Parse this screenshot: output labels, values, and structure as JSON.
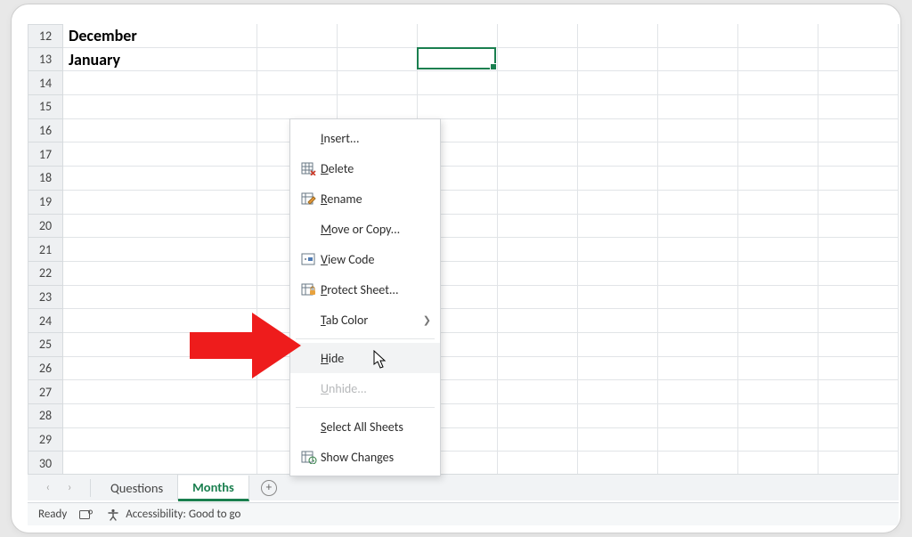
{
  "rows": {
    "start": 12,
    "end": 30,
    "data": {
      "12": {
        "A": "December"
      },
      "13": {
        "A": "January"
      }
    }
  },
  "selection": {
    "cell": "D13"
  },
  "tabs": {
    "items": [
      {
        "name": "Questions",
        "active": false
      },
      {
        "name": "Months",
        "active": true
      }
    ]
  },
  "context_menu": {
    "items": [
      {
        "label_pre": "",
        "mnemonic": "I",
        "label_post": "nsert...",
        "icon": "",
        "enabled": true
      },
      {
        "label_pre": "",
        "mnemonic": "D",
        "label_post": "elete",
        "icon": "table-delete",
        "enabled": true
      },
      {
        "label_pre": "",
        "mnemonic": "R",
        "label_post": "ename",
        "icon": "rename",
        "enabled": true
      },
      {
        "label_pre": "",
        "mnemonic": "M",
        "label_post": "ove or Copy...",
        "icon": "",
        "enabled": true
      },
      {
        "label_pre": "",
        "mnemonic": "V",
        "label_post": "iew Code",
        "icon": "code",
        "enabled": true
      },
      {
        "label_pre": "",
        "mnemonic": "P",
        "label_post": "rotect Sheet...",
        "icon": "lock",
        "enabled": true
      },
      {
        "label_pre": "",
        "mnemonic": "T",
        "label_post": "ab Color",
        "icon": "",
        "enabled": true,
        "submenu": true
      },
      {
        "sep": true
      },
      {
        "label_pre": "",
        "mnemonic": "H",
        "label_post": "ide",
        "icon": "",
        "enabled": true,
        "hover": true
      },
      {
        "label_pre": "",
        "mnemonic": "U",
        "label_post": "nhide...",
        "icon": "",
        "enabled": false
      },
      {
        "sep": true
      },
      {
        "label_pre": "",
        "mnemonic": "S",
        "label_post": "elect All Sheets",
        "icon": "",
        "enabled": true
      },
      {
        "label_pre": "Show Changes",
        "mnemonic": "",
        "label_post": "",
        "icon": "changes",
        "enabled": true
      }
    ]
  },
  "status": {
    "ready": "Ready",
    "accessibility": "Accessibility: Good to go"
  },
  "colors": {
    "accent": "#1a7f4f",
    "arrow": "#ee1c1c"
  }
}
